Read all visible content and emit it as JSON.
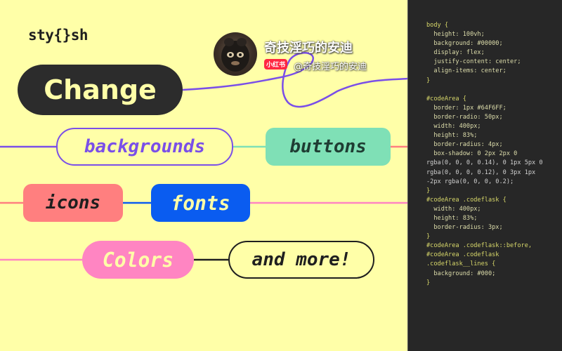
{
  "logo": {
    "text": "sty{}sh"
  },
  "tags": {
    "change": "Change",
    "backgrounds": "backgrounds",
    "buttons": "buttons",
    "icons": "icons",
    "fonts": "fonts",
    "colors": "Colors",
    "more": "and more!"
  },
  "watermark": {
    "title": "奇技淫巧的安迪",
    "badge": "小红书",
    "handle": "@奇技淫巧的安迪"
  },
  "colors": {
    "background": "#FFFFA8",
    "dark": "#2C2C2C",
    "purple": "#7A4FE8",
    "mint": "#7FE0B6",
    "coral": "#FF7F7F",
    "blue": "#0A5CF0",
    "pink": "#FF85C2",
    "code_bg": "#272727"
  },
  "code": [
    "body {",
    "  height: 100vh;",
    "  background: #00000;",
    "  display: flex;",
    "  justify-content: center;",
    "  align-items: center;",
    "}",
    "",
    "#codeArea {",
    "  border: 1px #64F6FF;",
    "  border-radio: 50px;",
    "  width: 400px;",
    "  height: 83%;",
    "  border-radius: 4px;",
    "  box-shadow: 0 2px 2px 0",
    "rgba(0, 0, 0, 0.14), 0 1px 5px 0",
    "rgba(0, 0, 0, 0.12), 0 3px 1px",
    "-2px rgba(0, 0, 0, 0.2);",
    "}",
    "#codeArea .codeflask {",
    "  width: 400px;",
    "  height: 83%;",
    "  border-radius: 3px;",
    "}",
    "#codeArea .codeflask::before,",
    "#codeArea .codeflask",
    ".codeflask__lines {",
    "  background: #000;",
    "}"
  ]
}
